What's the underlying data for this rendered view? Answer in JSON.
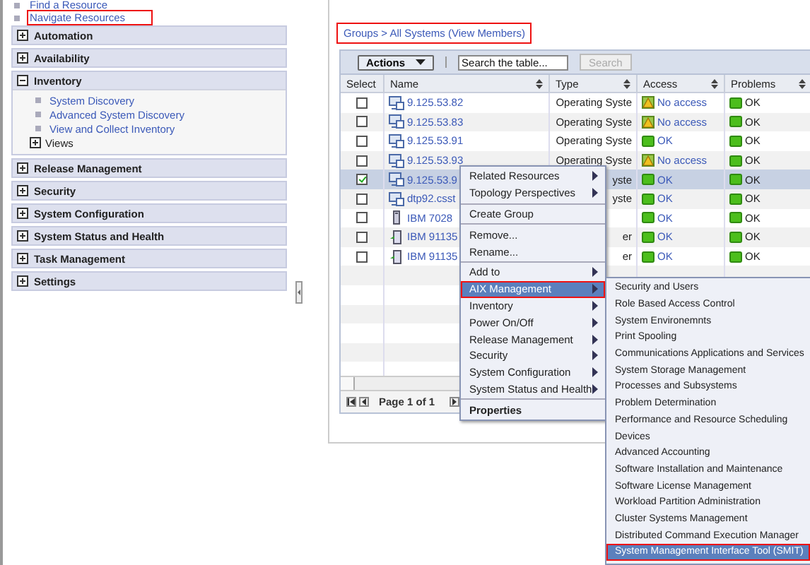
{
  "nav": {
    "links": [
      {
        "label": "Find a Resource"
      },
      {
        "label": "Navigate Resources",
        "callout": true
      }
    ],
    "sections": [
      {
        "label": "Automation",
        "expanded": false
      },
      {
        "label": "Availability",
        "expanded": false
      },
      {
        "label": "Inventory",
        "expanded": true,
        "children": [
          {
            "label": "System Discovery",
            "kind": "link"
          },
          {
            "label": "Advanced System Discovery",
            "kind": "link"
          },
          {
            "label": "View and Collect Inventory",
            "kind": "link"
          },
          {
            "label": "Views",
            "kind": "group",
            "expanded": false
          }
        ]
      },
      {
        "label": "Release Management",
        "expanded": false
      },
      {
        "label": "Security",
        "expanded": false
      },
      {
        "label": "System Configuration",
        "expanded": false
      },
      {
        "label": "System Status and Health",
        "expanded": false
      },
      {
        "label": "Task Management",
        "expanded": false
      },
      {
        "label": "Settings",
        "expanded": false
      }
    ]
  },
  "breadcrumb": {
    "text": "Groups > All Systems (View Members)",
    "callout": true
  },
  "table": {
    "toolbar": {
      "actions": "Actions",
      "search": {
        "placeholder": "Search the table..."
      },
      "search_button": {
        "label": "Search",
        "disabled": true
      }
    },
    "columns": [
      "Select",
      "Name",
      "Type",
      "Access",
      "Problems"
    ],
    "rows": [
      {
        "checked": false,
        "selected": false,
        "kind": "os",
        "name": "9.125.53.82",
        "type": "Operating Syste",
        "access": {
          "kind": "warning",
          "label": "No access"
        },
        "problems": "OK"
      },
      {
        "checked": false,
        "selected": false,
        "kind": "os",
        "name": "9.125.53.83",
        "type": "Operating Syste",
        "access": {
          "kind": "warning",
          "label": "No access"
        },
        "problems": "OK"
      },
      {
        "checked": false,
        "selected": false,
        "kind": "os",
        "name": "9.125.53.91",
        "type": "Operating Syste",
        "access": {
          "kind": "ok",
          "label": "OK"
        },
        "problems": "OK"
      },
      {
        "checked": false,
        "selected": false,
        "kind": "os",
        "name": "9.125.53.93",
        "type": "Operating Syste",
        "access": {
          "kind": "warning",
          "label": "No access"
        },
        "problems": "OK"
      },
      {
        "checked": true,
        "selected": true,
        "kind": "os",
        "name": "9.125.53.9",
        "type": "yste",
        "access": {
          "kind": "ok",
          "label": "OK"
        },
        "problems": "OK"
      },
      {
        "checked": false,
        "selected": false,
        "kind": "os",
        "name": "dtp92.csst",
        "type": "yste",
        "access": {
          "kind": "ok",
          "label": "OK"
        },
        "problems": "OK"
      },
      {
        "checked": false,
        "selected": false,
        "kind": "tower",
        "name": "IBM 7028",
        "access": {
          "kind": "ok",
          "label": "OK"
        },
        "problems": "OK"
      },
      {
        "checked": false,
        "selected": false,
        "kind": "server",
        "name": "IBM 91135",
        "type": "er",
        "access": {
          "kind": "ok",
          "label": "OK"
        },
        "problems": "OK"
      },
      {
        "checked": false,
        "selected": false,
        "kind": "server",
        "name": "IBM 91135",
        "type": "er",
        "access": {
          "kind": "ok",
          "label": "OK"
        },
        "problems": "OK"
      }
    ],
    "pager": "Page 1 of 1"
  },
  "context_menu": {
    "groups": [
      [
        {
          "label": "Related Resources",
          "submenu": true,
          "selected": false,
          "default": false
        },
        {
          "label": "Topology Perspectives",
          "submenu": true,
          "selected": false,
          "default": false
        }
      ],
      [
        {
          "label": "Create Group",
          "submenu": false,
          "selected": false,
          "default": false
        }
      ],
      [
        {
          "label": "Remove...",
          "submenu": false,
          "selected": false,
          "default": false
        },
        {
          "label": "Rename...",
          "submenu": false,
          "selected": false,
          "default": false
        }
      ],
      [
        {
          "label": "Add to",
          "submenu": true,
          "selected": false,
          "default": false
        },
        {
          "label": "AIX Management",
          "submenu": true,
          "selected": true,
          "default": false,
          "callout": true
        },
        {
          "label": "Inventory",
          "submenu": true,
          "selected": false,
          "default": false
        },
        {
          "label": "Power On/Off",
          "submenu": true,
          "selected": false,
          "default": false
        },
        {
          "label": "Release Management",
          "submenu": true,
          "selected": false,
          "default": false
        },
        {
          "label": "Security",
          "submenu": true,
          "selected": false,
          "default": false
        },
        {
          "label": "System Configuration",
          "submenu": true,
          "selected": false,
          "default": false
        },
        {
          "label": "System Status and Health",
          "submenu": true,
          "selected": false,
          "default": false
        }
      ],
      [
        {
          "label": "Properties",
          "submenu": false,
          "selected": false,
          "default": true
        }
      ]
    ]
  },
  "submenu": {
    "items": [
      {
        "label": "Security and Users",
        "selected": false
      },
      {
        "label": "Role Based Access Control",
        "selected": false
      },
      {
        "label": "System Environemnts",
        "selected": false
      },
      {
        "label": "Print Spooling",
        "selected": false
      },
      {
        "label": "Communications Applications and Services",
        "selected": false
      },
      {
        "label": "System Storage Management",
        "selected": false
      },
      {
        "label": "Processes and Subsystems",
        "selected": false
      },
      {
        "label": "Problem Determination",
        "selected": false
      },
      {
        "label": "Performance and Resource Scheduling",
        "selected": false
      },
      {
        "label": "Devices",
        "selected": false
      },
      {
        "label": "Advanced Accounting",
        "selected": false
      },
      {
        "label": "Software Installation and Maintenance",
        "selected": false
      },
      {
        "label": "Software License Management",
        "selected": false
      },
      {
        "label": "Workload Partition Administration",
        "selected": false
      },
      {
        "label": "Cluster Systems Management",
        "selected": false
      },
      {
        "label": "Distributed Command Execution Manager",
        "selected": false
      },
      {
        "label": "System Management Interface Tool (SMIT)",
        "selected": true,
        "callout": true
      }
    ]
  }
}
